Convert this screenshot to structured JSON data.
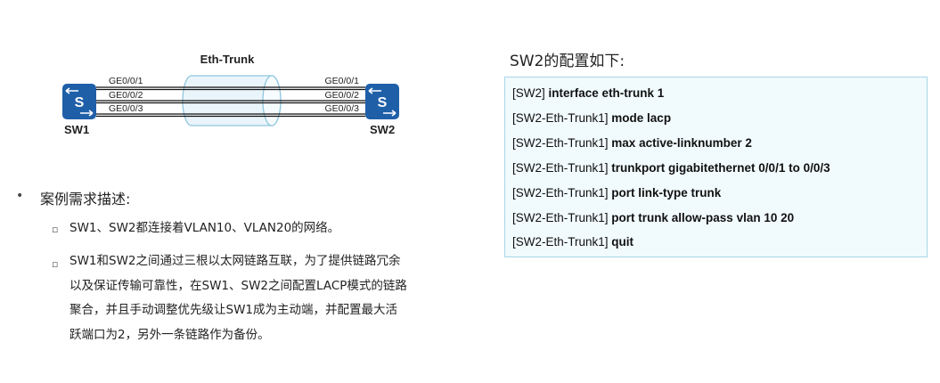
{
  "diagram": {
    "trunk_label": "Eth-Trunk",
    "left_switch": {
      "name": "SW1",
      "letter": "S",
      "ports": [
        "GE0/0/1",
        "GE0/0/2",
        "GE0/0/3"
      ]
    },
    "right_switch": {
      "name": "SW2",
      "letter": "S",
      "ports": [
        "GE0/0/1",
        "GE0/0/2",
        "GE0/0/3"
      ]
    },
    "colors": {
      "switch": "#1f5fa8",
      "trunk_fill": "#e9f5fb",
      "trunk_stroke": "#8fc6de"
    }
  },
  "requirements": {
    "bullet": "•",
    "title": "案例需求描述:",
    "sub_mark": "▫",
    "item1": "SW1、SW2都连接着VLAN10、VLAN20的网络。",
    "item2_lines": [
      "SW1和SW2之间通过三根以太网链路互联，为了提供链路冗余",
      "以及保证传输可靠性，在SW1、SW2之间配置LACP模式的链路",
      "聚合，并且手动调整优先级让SW1成为主动端，并配置最大活",
      "跃端口为2，另外一条链路作为备份。"
    ]
  },
  "config": {
    "title": "SW2的配置如下:",
    "lines": [
      {
        "prompt": "[SW2]",
        "command": "interface eth-trunk 1"
      },
      {
        "prompt": "[SW2-Eth-Trunk1]",
        "command": "mode lacp"
      },
      {
        "prompt": "[SW2-Eth-Trunk1]",
        "command": "max active-linknumber 2"
      },
      {
        "prompt": "[SW2-Eth-Trunk1]",
        "command": "trunkport gigabitethernet 0/0/1 to 0/0/3"
      },
      {
        "prompt": "[SW2-Eth-Trunk1]",
        "command": "port link-type trunk"
      },
      {
        "prompt": "[SW2-Eth-Trunk1]",
        "command": "port trunk allow-pass vlan 10 20"
      },
      {
        "prompt": "[SW2-Eth-Trunk1]",
        "command": "quit"
      }
    ]
  }
}
